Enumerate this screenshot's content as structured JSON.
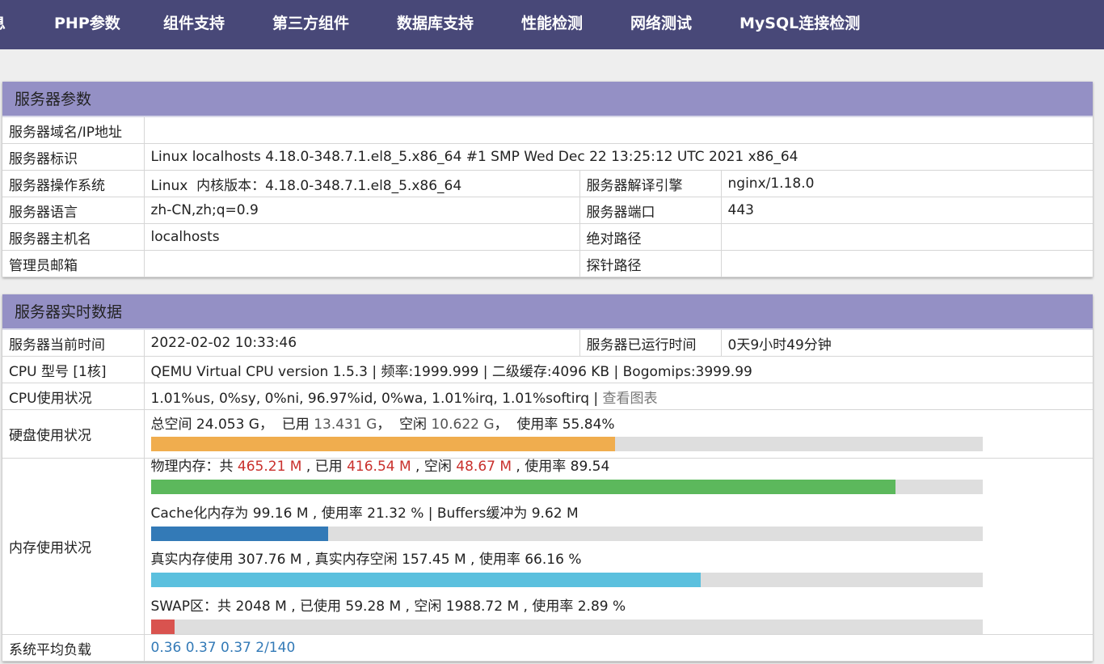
{
  "nav": {
    "items": [
      "息",
      "PHP参数",
      "组件支持",
      "第三方组件",
      "数据库支持",
      "性能检测",
      "网络测试",
      "MySQL连接检测"
    ]
  },
  "server_params": {
    "title": "服务器参数",
    "domain_label": "服务器域名/IP地址",
    "domain_value": "",
    "ident_label": "服务器标识",
    "ident_value": "Linux localhosts 4.18.0-348.7.1.el8_5.x86_64 #1 SMP Wed Dec 22 13:25:12 UTC 2021 x86_64",
    "os_label": "服务器操作系统",
    "os_value": "Linux  内核版本：4.18.0-348.7.1.el8_5.x86_64",
    "engine_label": "服务器解译引擎",
    "engine_value": "nginx/1.18.0",
    "lang_label": "服务器语言",
    "lang_value": "zh-CN,zh;q=0.9",
    "port_label": "服务器端口",
    "port_value": "443",
    "host_label": "服务器主机名",
    "host_value": "localhosts",
    "abspath_label": "绝对路径",
    "abspath_value": "",
    "email_label": "管理员邮箱",
    "email_value": "",
    "probe_label": "探针路径",
    "probe_value": ""
  },
  "realtime": {
    "title": "服务器实时数据",
    "time_label": "服务器当前时间",
    "time_value": "2022-02-02 10:33:46",
    "uptime_label": "服务器已运行时间",
    "uptime_value": "0天9小时49分钟",
    "cpu_model_label": "CPU 型号 [1核]",
    "cpu_model_value": "QEMU Virtual CPU version 1.5.3 | 频率:1999.999 | 二级缓存:4096 KB | Bogomips:3999.99",
    "cpu_usage_label": "CPU使用状况",
    "cpu_usage_value": "1.01%us, 0%sy, 0%ni, 96.97%id, 0%wa, 1.01%irq, 1.01%softirq",
    "cpu_sep": " | ",
    "cpu_chart_link": "查看图表",
    "disk": {
      "label": "硬盘使用状况",
      "t1": "总空间 24.053 G，  已用 ",
      "used": "13.431 G",
      "t2": "，  空闲 ",
      "free": "10.622 G",
      "t3": "，  使用率 55.84%",
      "percent": 55.84,
      "color": "#f0ad4e"
    },
    "memory": {
      "label": "内存使用状况",
      "physical": {
        "t1": "物理内存：共 ",
        "total": "465.21 M",
        "t2": " , 已用 ",
        "used": "416.54 M",
        "t3": " , 空闲 ",
        "free": "48.67 M",
        "t4": " , 使用率 89.54",
        "percent": 89.54,
        "color": "#5cb85c"
      },
      "cache": {
        "text": "Cache化内存为 99.16 M , 使用率 21.32 % | Buffers缓冲为 9.62 M",
        "percent": 21.32,
        "color": "#337ab7"
      },
      "real": {
        "text": "真实内存使用 307.76 M , 真实内存空闲 157.45 M , 使用率 66.16 %",
        "percent": 66.16,
        "color": "#5bc0de"
      },
      "swap": {
        "text": "SWAP区：共 2048 M , 已使用 59.28 M , 空闲 1988.72 M , 使用率 2.89 %",
        "percent": 2.89,
        "color": "#d9534f"
      }
    },
    "load_label": "系统平均负载",
    "load_value": "0.36 0.37 0.37 2/140"
  }
}
